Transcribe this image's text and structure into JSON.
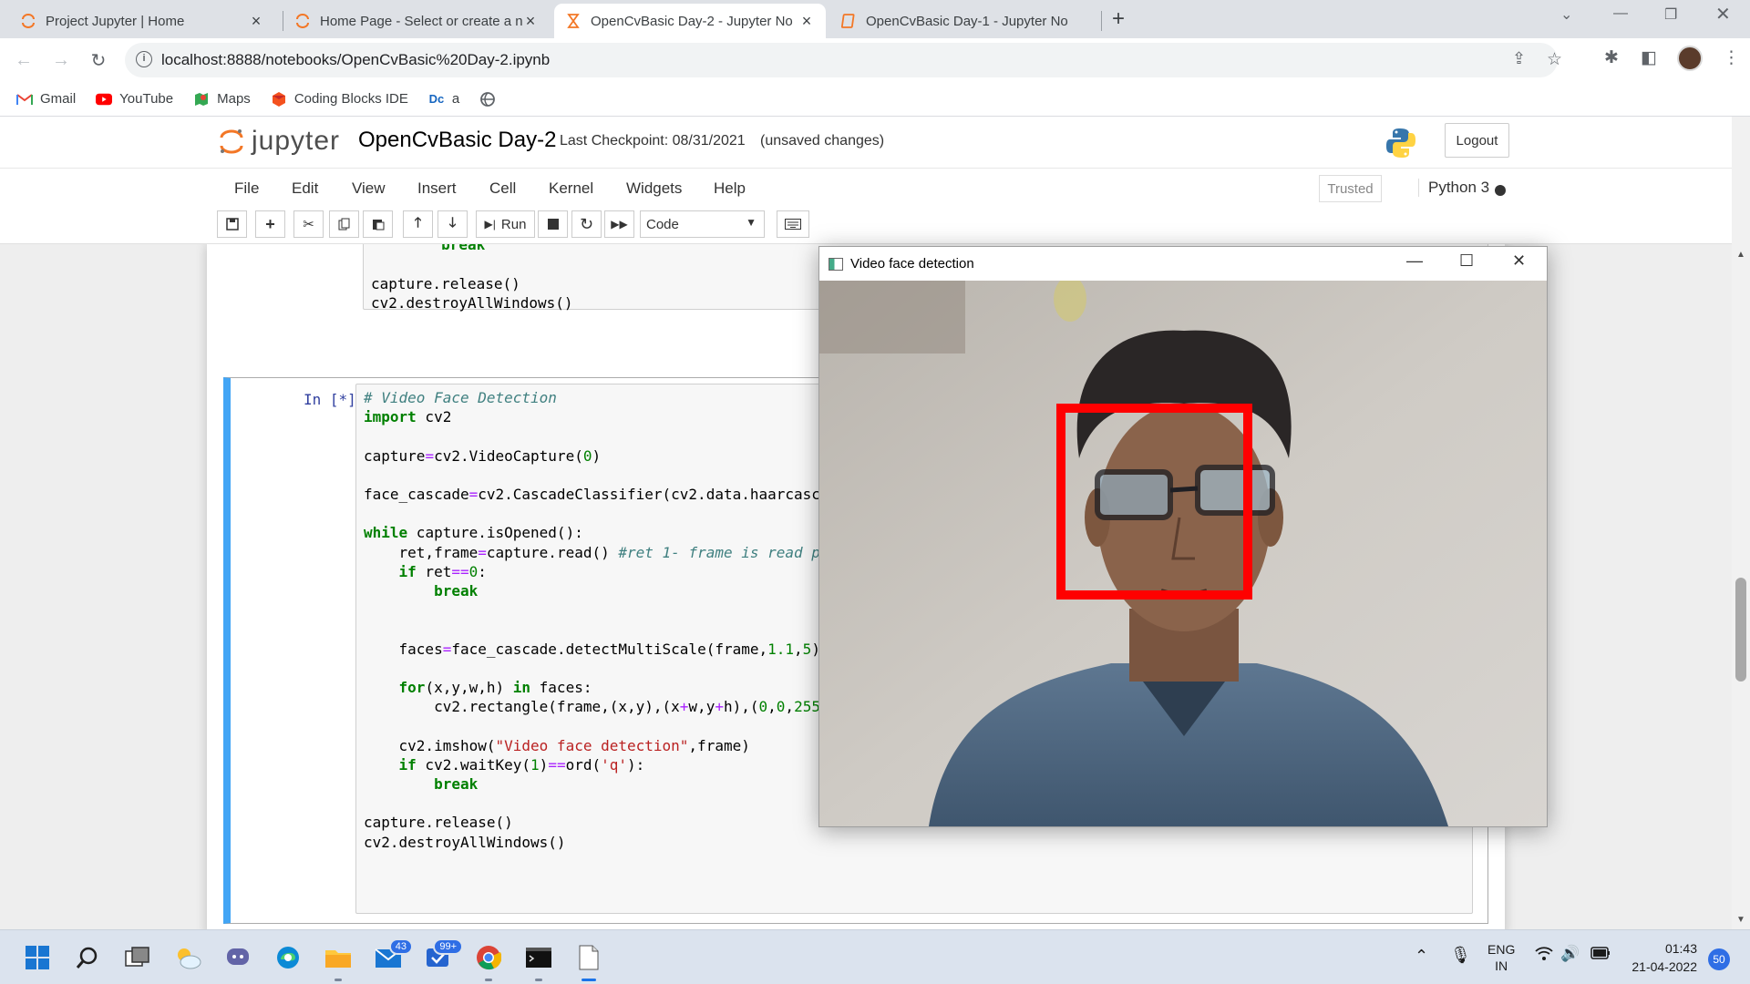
{
  "browser": {
    "tabs": [
      {
        "title": "Project Jupyter | Home",
        "active": false
      },
      {
        "title": "Home Page - Select or create a n",
        "active": false
      },
      {
        "title": "OpenCvBasic Day-2 - Jupyter No",
        "active": true
      },
      {
        "title": "OpenCvBasic Day-1 - Jupyter No",
        "active": false
      }
    ],
    "url": "localhost:8888/notebooks/OpenCvBasic%20Day-2.ipynb",
    "bookmarks": [
      "Gmail",
      "YouTube",
      "Maps",
      "Coding Blocks IDE",
      "a"
    ]
  },
  "jupyter": {
    "logo_text": "jupyter",
    "notebook_name": "OpenCvBasic Day-2",
    "checkpoint": "Last Checkpoint: 08/31/2021",
    "unsaved": "(unsaved changes)",
    "logout": "Logout",
    "menu": [
      "File",
      "Edit",
      "View",
      "Insert",
      "Cell",
      "Kernel",
      "Widgets",
      "Help"
    ],
    "trusted": "Trusted",
    "kernel_name": "Python 3",
    "toolbar": {
      "run_label": "Run",
      "cell_type": "Code"
    },
    "cell2_prompt": "In [*]:"
  },
  "cv_window": {
    "title": "Video face detection"
  },
  "taskbar": {
    "mail_badge": "43",
    "todo_badge": "99+",
    "language": "ENG",
    "region": "IN",
    "time": "01:43",
    "date": "21-04-2022",
    "notifications": "50"
  },
  "colors": {
    "selected_cell_border": "#42a5f5",
    "keyword": "#008000",
    "string": "#ba2121",
    "comment": "#408080",
    "face_box": "#ff0000",
    "jupyter_orange": "#f37726"
  },
  "icons": [
    "save-icon",
    "plus-icon",
    "scissors-icon",
    "copy-icon",
    "paste-icon",
    "arrow-up-icon",
    "arrow-down-icon",
    "stop-icon",
    "restart-icon",
    "fast-forward-icon",
    "keyboard-icon"
  ]
}
